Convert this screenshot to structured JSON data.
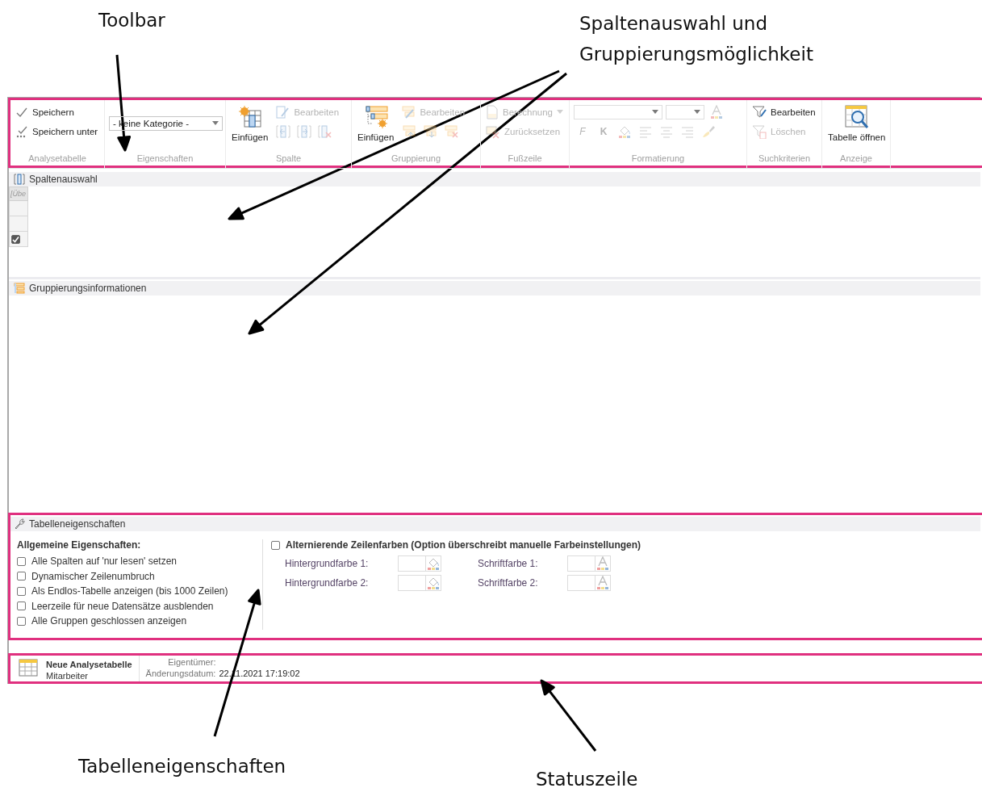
{
  "annotations": [
    {
      "kind": "toolbar",
      "text": "Toolbar"
    },
    {
      "kind": "columns-grouping",
      "text": "Spaltenauswahl und\nGruppierungsmöglichkeit"
    },
    {
      "kind": "table-properties",
      "text": "Tabelleneigenschaften"
    },
    {
      "kind": "status-bar",
      "text": "Statuszeile"
    }
  ],
  "toolbar": {
    "groups": [
      {
        "label": "Analysetabelle",
        "items": [
          {
            "kind": "small",
            "label": "Speichern",
            "disabled": false
          },
          {
            "kind": "small",
            "label": "Speichern unter",
            "disabled": false
          }
        ]
      },
      {
        "label": "Eigenschaften",
        "items": [
          {
            "kind": "combo",
            "value": "- keine Kategorie -",
            "disabled": false
          }
        ]
      },
      {
        "label": "Spalte",
        "items": [
          {
            "kind": "large",
            "label": "Einfügen",
            "disabled": false
          },
          {
            "kind": "small",
            "label": "Bearbeiten",
            "disabled": true
          },
          {
            "kind": "tool",
            "disabled": true
          },
          {
            "kind": "tool",
            "disabled": true
          },
          {
            "kind": "tool",
            "disabled": true
          }
        ]
      },
      {
        "label": "Gruppierung",
        "items": [
          {
            "kind": "large",
            "label": "Einfügen",
            "disabled": false
          },
          {
            "kind": "small",
            "label": "Bearbeiten",
            "disabled": true
          },
          {
            "kind": "tool",
            "disabled": true
          },
          {
            "kind": "tool",
            "disabled": true
          },
          {
            "kind": "tool",
            "disabled": true
          }
        ]
      },
      {
        "label": "Fußzeile",
        "items": [
          {
            "kind": "small",
            "label": "Berechnung",
            "has_menu": true,
            "disabled": true
          },
          {
            "kind": "small",
            "label": "Zurücksetzen",
            "disabled": true
          }
        ]
      },
      {
        "label": "Formatierung",
        "items": [
          {
            "kind": "combo",
            "disabled": true
          },
          {
            "kind": "combo-small",
            "disabled": true
          },
          {
            "kind": "tool",
            "disabled": true
          },
          {
            "kind": "letter",
            "label": "F",
            "disabled": true
          },
          {
            "kind": "letter",
            "label": "K",
            "disabled": true
          },
          {
            "kind": "tool",
            "disabled": true
          },
          {
            "kind": "tool",
            "disabled": true
          },
          {
            "kind": "tool",
            "disabled": true
          },
          {
            "kind": "tool",
            "disabled": true
          },
          {
            "kind": "tool",
            "disabled": true
          }
        ]
      },
      {
        "label": "Suchkriterien",
        "items": [
          {
            "kind": "small",
            "label": "Bearbeiten",
            "disabled": false
          },
          {
            "kind": "small",
            "label": "Löschen",
            "disabled": true
          }
        ]
      },
      {
        "label": "Anzeige",
        "items": [
          {
            "kind": "large",
            "label": "Tabelle öffnen",
            "disabled": false
          }
        ]
      }
    ]
  },
  "column_selection": {
    "title": "Spaltenauswahl",
    "grid": {
      "header": "[Übe",
      "cells": [
        {
          "kind": "empty"
        },
        {
          "kind": "empty"
        },
        {
          "kind": "checkbox",
          "checked": true
        }
      ]
    }
  },
  "grouping": {
    "title": "Gruppierungsinformationen"
  },
  "table_properties": {
    "title": "Tabelleneigenschaften",
    "general": {
      "heading": "Allgemeine Eigenschaften:",
      "options": [
        {
          "label": "Alle Spalten auf 'nur lesen' setzen",
          "checked": false
        },
        {
          "label": "Dynamischer Zeilenumbruch",
          "checked": false
        },
        {
          "label": "Als Endlos-Tabelle anzeigen (bis 1000 Zeilen)",
          "checked": false
        },
        {
          "label": "Leerzeile für neue Datensätze ausblenden",
          "checked": false
        },
        {
          "label": "Alle Gruppen geschlossen anzeigen",
          "checked": false
        }
      ]
    },
    "alternating": {
      "label": "Alternierende Zeilenfarben (Option überschreibt manuelle Farbeinstellungen)",
      "checked": false,
      "colors": [
        {
          "kind": "background",
          "label": "Hintergrundfarbe 1:"
        },
        {
          "kind": "font",
          "label": "Schriftfarbe 1:"
        },
        {
          "kind": "background",
          "label": "Hintergrundfarbe 2:"
        },
        {
          "kind": "font",
          "label": "Schriftfarbe 2:"
        }
      ]
    }
  },
  "status_bar": {
    "name": "Neue Analysetabelle",
    "category": "Mitarbeiter",
    "owner_label": "Eigentümer:",
    "date_label": "Änderungsdatum:",
    "date": "22.11.2021 17:19:02"
  }
}
